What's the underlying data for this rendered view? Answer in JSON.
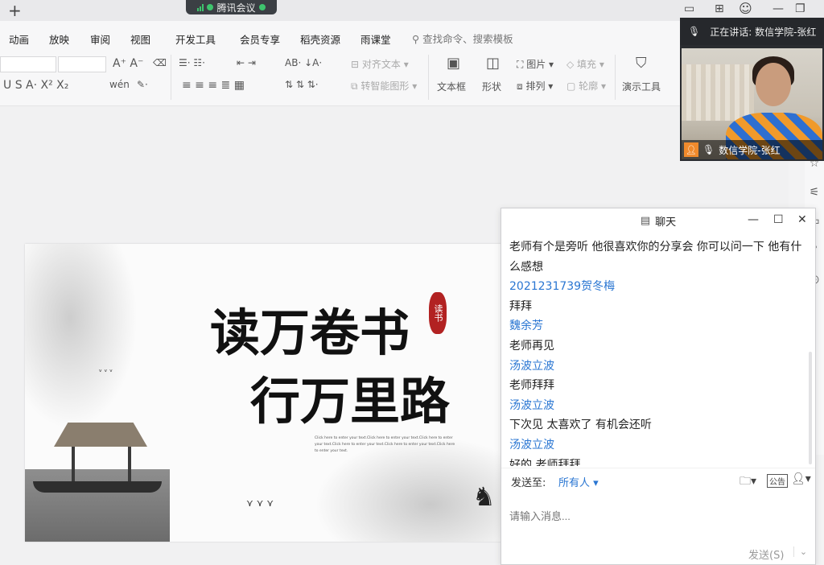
{
  "meeting": {
    "pill_label": "腾讯会议",
    "speaking_label": "正在讲话: 数信学院-张红",
    "participant_name": "数信学院-张红"
  },
  "menu": {
    "items": [
      "动画",
      "放映",
      "审阅",
      "视图",
      "开发工具",
      "会员专享",
      "稻壳资源",
      "雨课堂"
    ],
    "search": "查找命令、搜索模板"
  },
  "ribbon": {
    "align_text": "对齐文本",
    "smart_art": "转智能图形",
    "text_box": "文本框",
    "shape": "形状",
    "picture": "图片",
    "arrange": "排列",
    "fill": "填充",
    "outline": "轮廓",
    "present_tools": "演示工具",
    "pinyin": "wén"
  },
  "slide": {
    "line1": "读万卷书",
    "line2": "行万里路",
    "seal": "读书",
    "small_text": "Click here to enter your text.Click here to enter your text.Click here to enter your text.Click here to enter your text.Click here to enter your text.Click here to enter your text."
  },
  "chat": {
    "title": "聊天",
    "messages": [
      {
        "type": "text",
        "content": "老师有个是旁听 他很喜欢你的分享会  你可以问一下 他有什么感想"
      },
      {
        "type": "name",
        "content": "2021231739贺冬梅"
      },
      {
        "type": "text",
        "content": "拜拜"
      },
      {
        "type": "name",
        "content": "魏余芳"
      },
      {
        "type": "text",
        "content": "老师再见"
      },
      {
        "type": "name",
        "content": "汤波立波"
      },
      {
        "type": "text",
        "content": "老师拜拜"
      },
      {
        "type": "name",
        "content": "汤波立波"
      },
      {
        "type": "text",
        "content": "下次见 太喜欢了 有机会还听"
      },
      {
        "type": "name",
        "content": "汤波立波"
      },
      {
        "type": "text",
        "content": "好的 老师拜拜"
      }
    ],
    "send_to_label": "发送至:",
    "send_target": "所有人",
    "input_placeholder": "请输入消息...",
    "send_button": "发送(S)",
    "announce_label": "公告"
  }
}
